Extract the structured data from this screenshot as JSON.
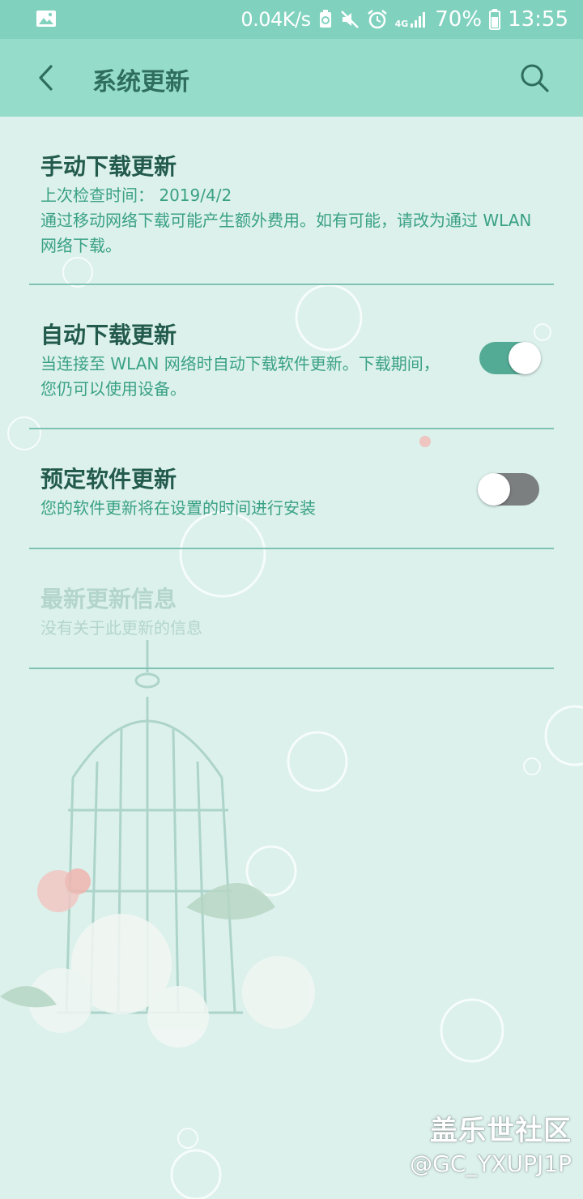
{
  "status_bar": {
    "net_speed": "0.04K/s",
    "network_tag": "4G",
    "battery": "70%",
    "time": "13:55",
    "icons": [
      "image-icon",
      "battery-saver-icon",
      "mute-icon",
      "alarm-icon",
      "signal-icon",
      "battery-icon"
    ]
  },
  "app_bar": {
    "title": "系统更新",
    "back_icon": "back-arrow-icon",
    "search_icon": "search-icon"
  },
  "settings": [
    {
      "title": "手动下载更新",
      "subtitle": "上次检查时间： 2019/4/2\n通过移动网络下载可能产生额外费用。如有可能，请改为通过 WLAN 网络下载。"
    },
    {
      "title": "自动下载更新",
      "subtitle": "当连接至 WLAN 网络时自动下载软件更新。下载期间，您仍可以使用设备。",
      "toggle": "on"
    },
    {
      "title": "预定软件更新",
      "subtitle": "您的软件更新将在设置的时间进行安装",
      "toggle": "off"
    },
    {
      "title": "最新更新信息",
      "subtitle": "没有关于此更新的信息",
      "disabled": true
    }
  ],
  "watermark": {
    "line1": "盖乐世社区",
    "line2": "@GC_YXUPJ1P"
  },
  "colors": {
    "status_bar": "#80d2bf",
    "app_bar": "#95dccb",
    "background": "#dcf1ec",
    "toggle_on": "#53ab95",
    "toggle_off": "#7b7f7f",
    "title_text": "#225a4c",
    "subtitle_text": "#3aa184"
  }
}
